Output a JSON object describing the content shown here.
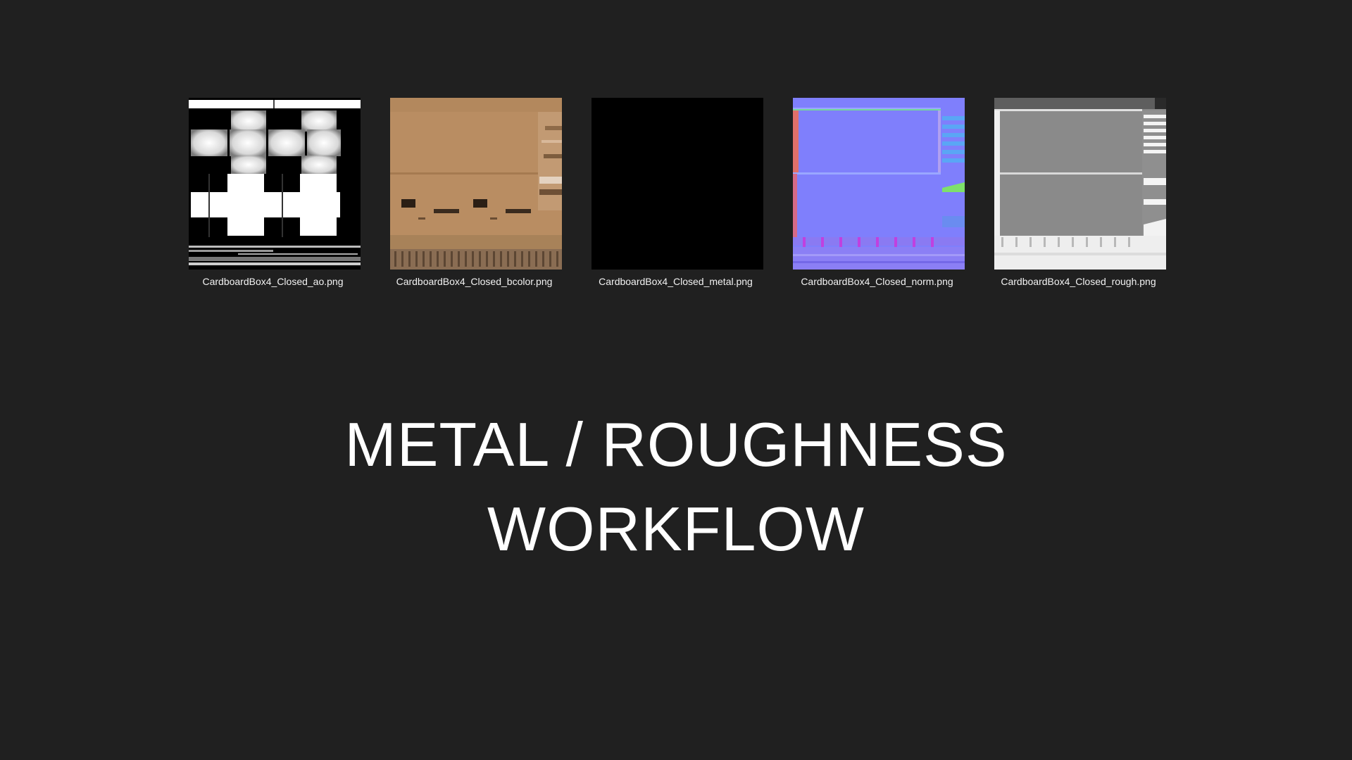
{
  "files": [
    {
      "name": "CardboardBox4_Closed_ao.png",
      "thumbnail": "ambient-occlusion-map"
    },
    {
      "name": "CardboardBox4_Closed_bcolor.png",
      "thumbnail": "base-color-map"
    },
    {
      "name": "CardboardBox4_Closed_metal.png",
      "thumbnail": "metalness-map"
    },
    {
      "name": "CardboardBox4_Closed_norm.png",
      "thumbnail": "normal-map"
    },
    {
      "name": "CardboardBox4_Closed_rough.png",
      "thumbnail": "roughness-map"
    }
  ],
  "heading": {
    "line1": "METAL / ROUGHNESS",
    "line2": "WORKFLOW"
  },
  "colors": {
    "background": "#202020",
    "text": "#ffffff",
    "cardboard": "#b98d62",
    "normal_blue": "#7f7ffc"
  }
}
